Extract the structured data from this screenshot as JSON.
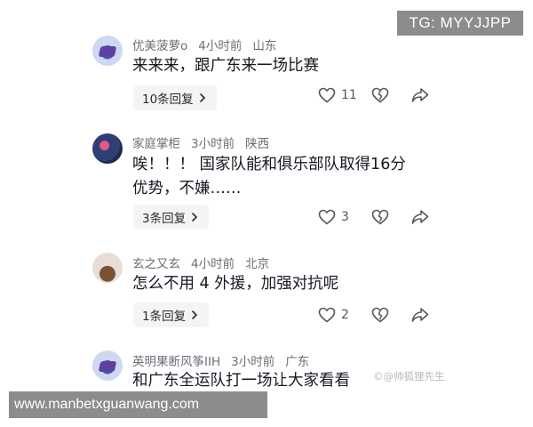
{
  "watermark_tg": "TG: MYYJJPP",
  "watermark_url": "www.manbetxguanwang.com",
  "watermark_author": "©@帅狐狸先生",
  "comments": [
    {
      "username": "优美菠萝o",
      "time": "4小时前",
      "location": "山东",
      "text_lines": [
        "来来来，跟广东来一场比赛"
      ],
      "replies_label": "10条回复",
      "likes": "11",
      "avatar": "avatar-icon"
    },
    {
      "username": "家庭掌柜",
      "time": "3小时前",
      "location": "陕西",
      "text_lines": [
        "唉！！！ 国家队能和俱乐部队取得16分",
        "优势，不嫌……"
      ],
      "replies_label": "3条回复",
      "likes": "3",
      "avatar": "avatar-icon"
    },
    {
      "username": "玄之又玄",
      "time": "4小时前",
      "location": "北京",
      "text_lines": [
        "怎么不用 4 外援，加强对抗呢"
      ],
      "replies_label": "1条回复",
      "likes": "2",
      "avatar": "avatar-icon"
    },
    {
      "username": "英明果断风筝IIH",
      "time": "3小时前",
      "location": "广东",
      "text_lines": [
        "和广东全运队打一场让大家看看"
      ],
      "avatar": "avatar-icon"
    }
  ],
  "colors": {
    "text": "#161823",
    "meta": "#6b6e77",
    "button_bg": "#f4f4f5",
    "banner_bg": "#8c8c8c"
  }
}
